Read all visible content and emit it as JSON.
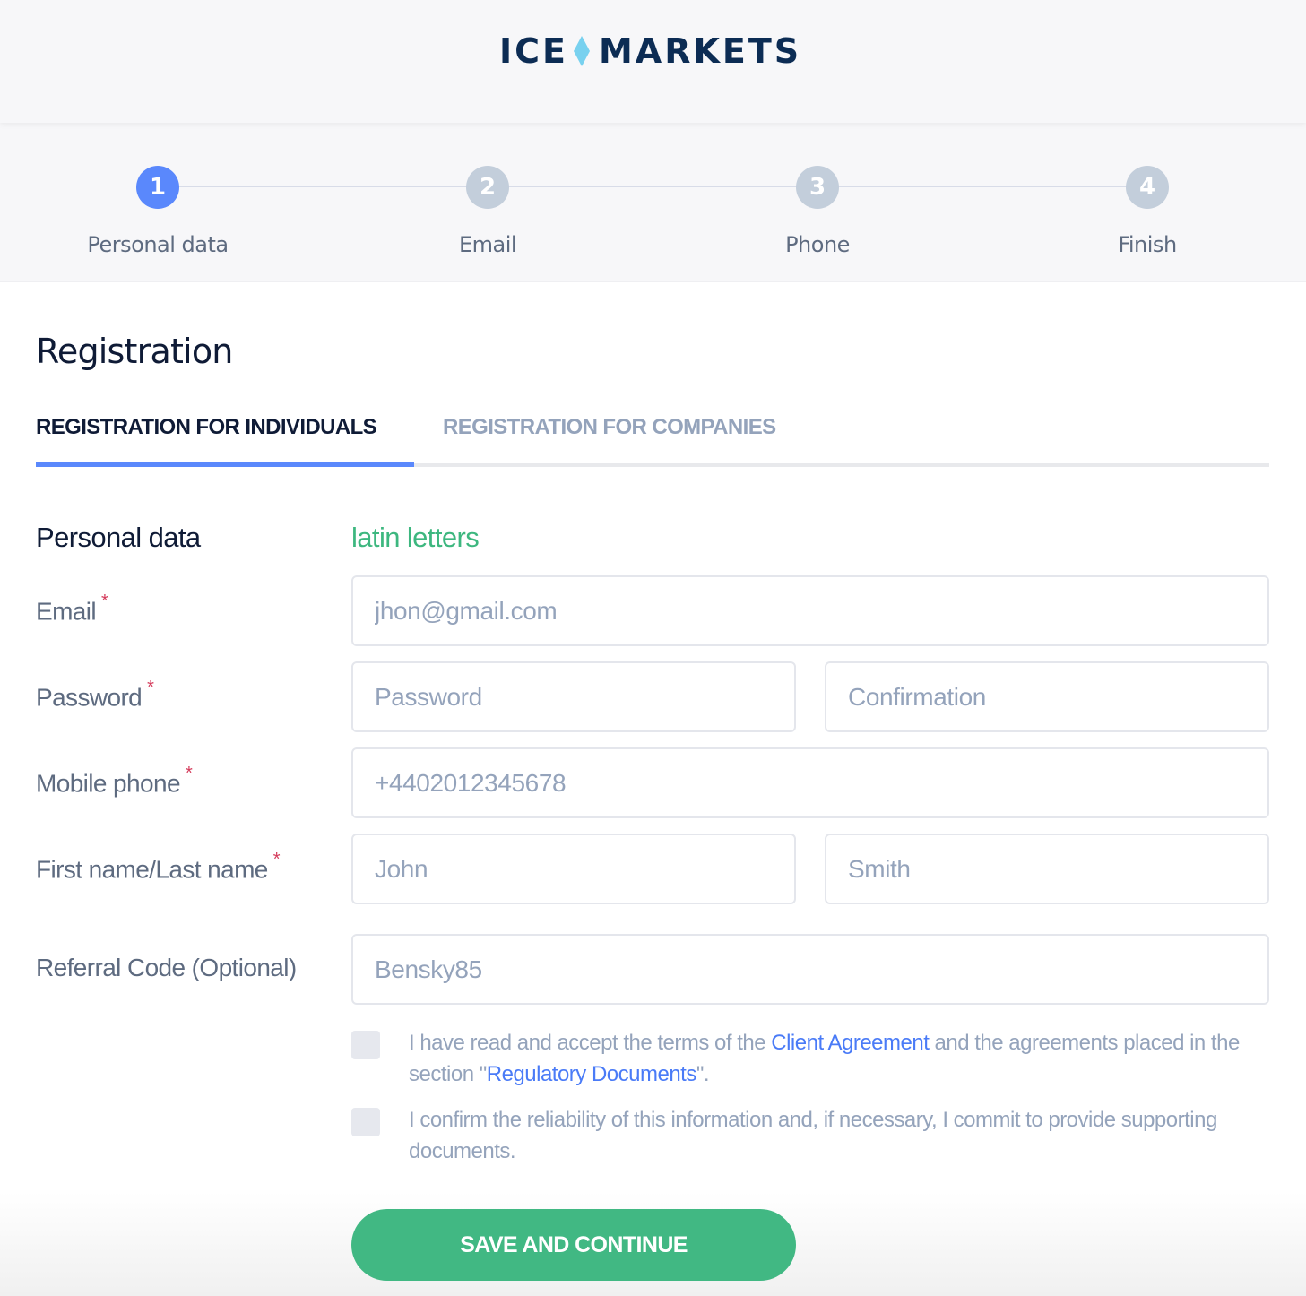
{
  "brand": {
    "name_left": "ICE",
    "name_right": "MARKETS",
    "logo_icon": "diamond-icon",
    "colors": {
      "text": "#0c2c54",
      "diamond": "#78d1ef"
    }
  },
  "stepper": {
    "active_step": 1,
    "steps": [
      {
        "number": "1",
        "label": "Personal data",
        "state": "active"
      },
      {
        "number": "2",
        "label": "Email",
        "state": "inactive"
      },
      {
        "number": "3",
        "label": "Phone",
        "state": "inactive"
      },
      {
        "number": "4",
        "label": "Finish",
        "state": "inactive"
      }
    ]
  },
  "page": {
    "title": "Registration"
  },
  "tabs": [
    {
      "label": "REGISTRATION FOR INDIVIDUALS",
      "active": true
    },
    {
      "label": "REGISTRATION FOR COMPANIES",
      "active": false
    }
  ],
  "form": {
    "section_title": "Personal data",
    "section_hint": "latin letters",
    "required_marker": "*",
    "fields": {
      "email": {
        "label": "Email",
        "required": true,
        "placeholder": "jhon@gmail.com",
        "value": ""
      },
      "password": {
        "label": "Password",
        "required": true,
        "placeholder": "Password",
        "value": ""
      },
      "confirmation": {
        "placeholder": "Confirmation",
        "value": ""
      },
      "mobile_phone": {
        "label": "Mobile phone",
        "required": true,
        "placeholder": "+4402012345678",
        "value": ""
      },
      "first_last_name": {
        "label": "First name/Last name",
        "required": true
      },
      "first_name": {
        "placeholder": "John",
        "value": ""
      },
      "last_name": {
        "placeholder": "Smith",
        "value": ""
      },
      "referral_code": {
        "label": "Referral Code (Optional)",
        "required": false,
        "placeholder": "Bensky85",
        "value": ""
      }
    },
    "agreements": [
      {
        "checked": false,
        "text_before": "I have read and accept the terms of the ",
        "link1": "Client Agreement",
        "text_middle": " and the agreements placed in the section \"",
        "link2": "Regulatory Documents",
        "text_after": "\"."
      },
      {
        "checked": false,
        "text": "I confirm the reliability of this information and, if necessary, I commit to provide supporting documents."
      }
    ],
    "submit_label": "SAVE AND CONTINUE"
  },
  "colors": {
    "accent": "#5a88fc",
    "step_inactive": "#c3cedb",
    "success": "#41b883",
    "hint": "#3db77f",
    "required": "#d43a5a",
    "link": "#4a7bf7",
    "muted_text": "#94a3bb",
    "label_text": "#5e6b80",
    "heading_text": "#0f1b36"
  }
}
